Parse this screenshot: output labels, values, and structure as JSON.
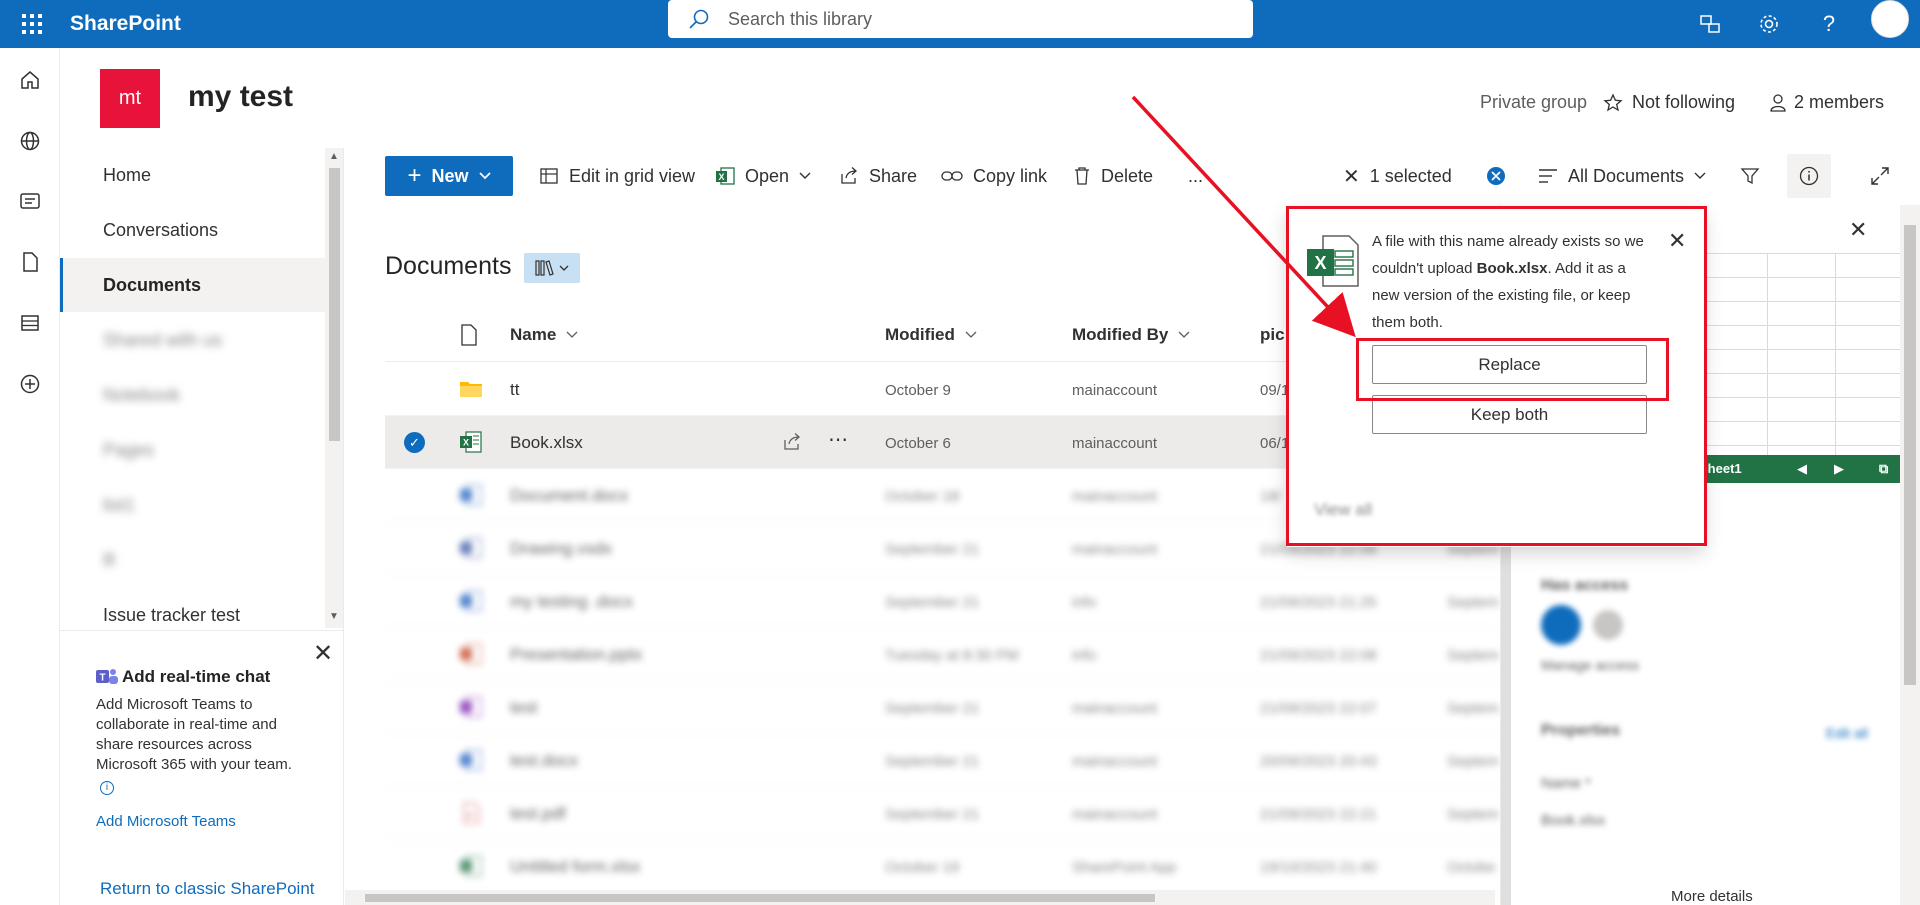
{
  "suite": {
    "brand": "SharePoint",
    "search_placeholder": "Search this library"
  },
  "site": {
    "logo_initials": "mt",
    "logo_color": "#e8133a",
    "title": "my test",
    "group_type": "Private group",
    "follow_label": "Not following",
    "members_label": "2 members"
  },
  "nav": {
    "items": [
      {
        "label": "Home"
      },
      {
        "label": "Conversations"
      },
      {
        "label": "Documents"
      },
      {
        "label": "Shared with us"
      },
      {
        "label": "Notebook"
      },
      {
        "label": "Pages"
      },
      {
        "label": "list1"
      },
      {
        "label": "lll"
      },
      {
        "label": "Issue tracker test"
      }
    ],
    "active_index": 2
  },
  "chat_card": {
    "title": "Add real-time chat",
    "body": "Add Microsoft Teams to collaborate in real-time and share resources across Microsoft 365 with your team.",
    "link": "Add Microsoft Teams"
  },
  "classic_link": "Return to classic SharePoint",
  "commands": {
    "new": "New",
    "edit_grid": "Edit in grid view",
    "open": "Open",
    "share": "Share",
    "copy_link": "Copy link",
    "delete": "Delete",
    "more": "...",
    "selected": "1 selected",
    "view": "All Documents"
  },
  "library": {
    "title": "Documents",
    "columns": {
      "name": "Name",
      "modified": "Modified",
      "modified_by": "Modified By",
      "extra": "pic"
    },
    "rows": [
      {
        "name": "tt",
        "modified": "October 9",
        "by": "mainaccount",
        "extra": "09/1",
        "type": "folder"
      },
      {
        "name": "Book.xlsx",
        "modified": "October 6",
        "by": "mainaccount",
        "extra": "06/1",
        "type": "excel",
        "selected": true
      },
      {
        "name": "Document.docx",
        "modified": "October 18",
        "by": "mainaccount",
        "extra": "18/",
        "type": "word"
      },
      {
        "name": "Drawing.vsdx",
        "modified": "September 21",
        "by": "mainaccount",
        "extra": "21/09/2023 22:06",
        "extra2": "Septem",
        "type": "visio"
      },
      {
        "name": "my testing .docx",
        "modified": "September 21",
        "by": "info",
        "extra": "21/09/2023 21:25",
        "extra2": "Septem",
        "type": "word"
      },
      {
        "name": "Presentation.pptx",
        "modified": "Tuesday at 8:30 PM",
        "by": "info",
        "extra": "21/09/2023 22:08",
        "extra2": "Septem",
        "type": "ppt"
      },
      {
        "name": "test",
        "modified": "September 21",
        "by": "mainaccount",
        "extra": "21/09/2023 22:07",
        "extra2": "Septem",
        "type": "onenote"
      },
      {
        "name": "test.docx",
        "modified": "September 21",
        "by": "mainaccount",
        "extra": "20/09/2023 20:43",
        "extra2": "Septem",
        "type": "word"
      },
      {
        "name": "test.pdf",
        "modified": "September 21",
        "by": "mainaccount",
        "extra": "21/09/2023 22:21",
        "extra2": "Septem",
        "type": "pdf"
      },
      {
        "name": "Untitled form.xlsx",
        "modified": "October 19",
        "by": "SharePoint App",
        "extra": "19/10/2023 21:40",
        "extra2": "Octobe",
        "type": "excel"
      }
    ]
  },
  "details_pane": {
    "sheet_tab": "Sheet1",
    "has_access": "Has access",
    "manage_access": "Manage access",
    "properties": "Properties",
    "edit_all": "Edit all",
    "name_label": "Name *",
    "name_value": "Book.xlsx",
    "more_details": "More details"
  },
  "callout": {
    "message_before": "A file with this name already exists so we couldn't upload ",
    "file_name": "Book.xlsx",
    "message_after": ". Add it as a new version of the existing file, or keep them both.",
    "replace": "Replace",
    "keep_both": "Keep both",
    "view_all": "View all"
  },
  "colors": {
    "suite_bar": "#0f6cbd",
    "annotation": "#e81123",
    "excel": "#217346"
  }
}
